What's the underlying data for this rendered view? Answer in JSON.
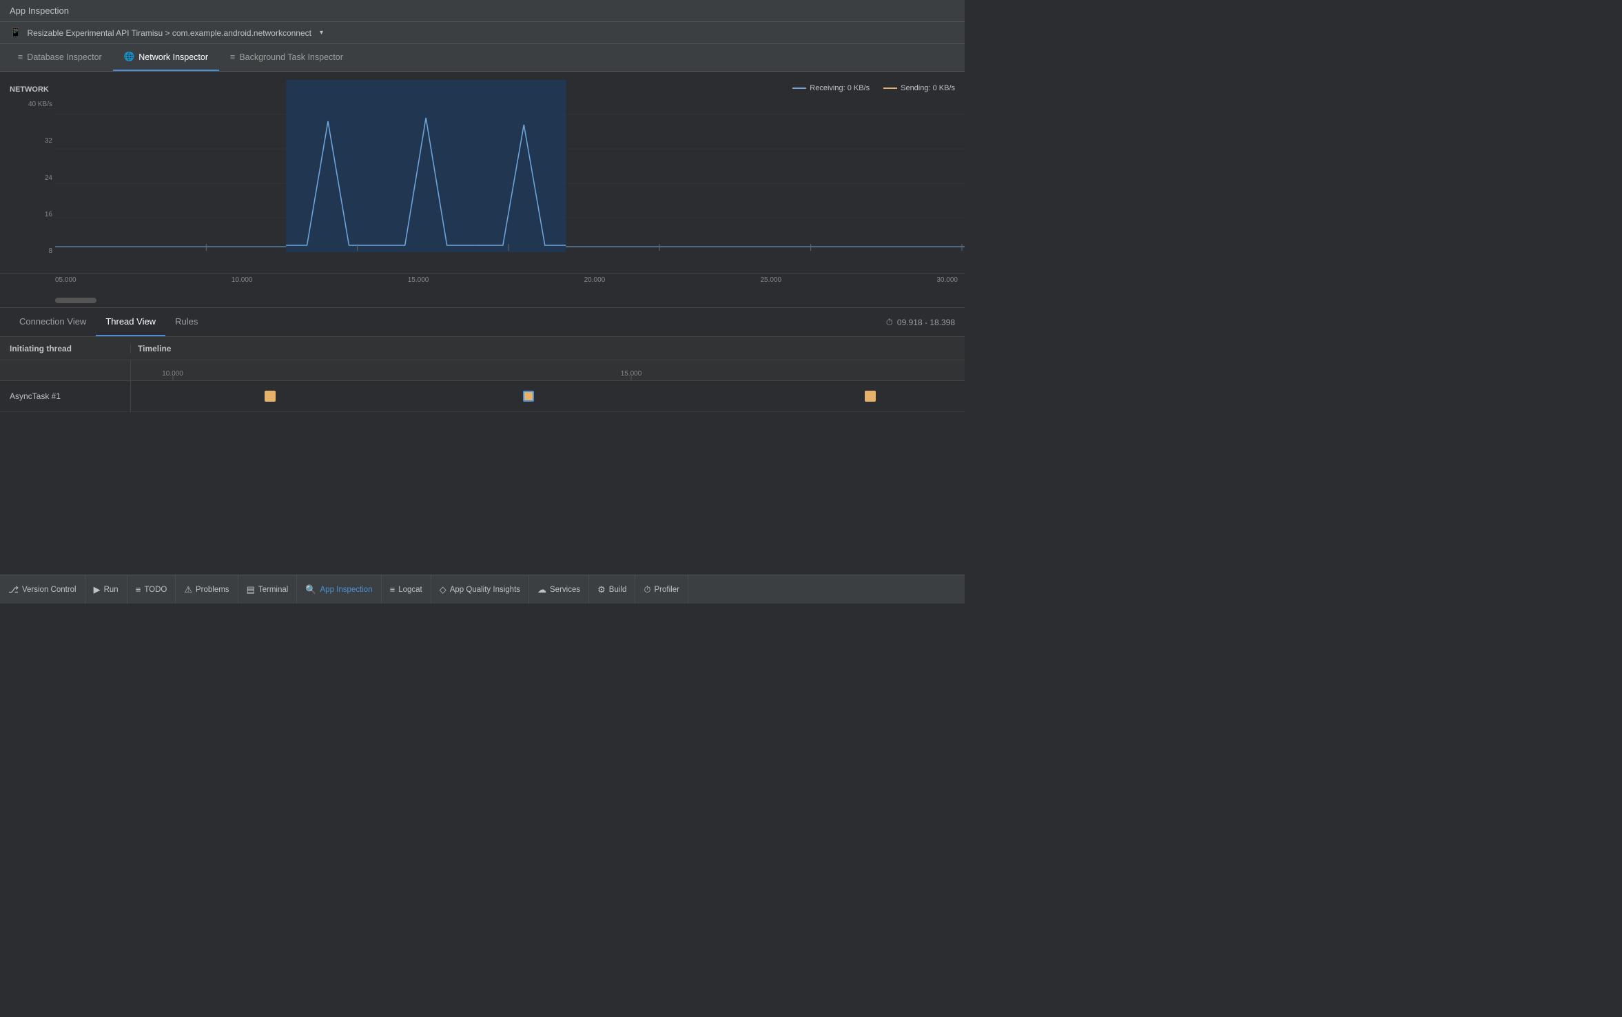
{
  "title_bar": {
    "label": "App Inspection"
  },
  "device_bar": {
    "icon": "📱",
    "label": "Resizable Experimental API Tiramisu > com.example.android.networkconnect",
    "dropdown_arrow": "▾"
  },
  "inspector_tabs": [
    {
      "id": "database",
      "label": "Database Inspector",
      "icon": "≡",
      "active": false
    },
    {
      "id": "network",
      "label": "Network Inspector",
      "icon": "🌐",
      "active": true
    },
    {
      "id": "background",
      "label": "Background Task Inspector",
      "icon": "≡",
      "active": false
    }
  ],
  "chart": {
    "title": "NETWORK",
    "y_label_top": "40 KB/s",
    "y_ticks": [
      "40 KB/s",
      "32",
      "24",
      "16",
      "8"
    ],
    "x_ticks": [
      "05.000",
      "10.000",
      "15.000",
      "20.000",
      "25.000",
      "30.000"
    ],
    "legend": {
      "receiving_label": "Receiving: 0 KB/s",
      "sending_label": "Sending: 0 KB/s"
    }
  },
  "view_tabs": [
    {
      "id": "connection",
      "label": "Connection View",
      "active": false
    },
    {
      "id": "thread",
      "label": "Thread View",
      "active": true
    },
    {
      "id": "rules",
      "label": "Rules",
      "active": false
    }
  ],
  "time_range": "09.918 - 18.398",
  "thread_header": {
    "initiating": "Initiating thread",
    "timeline": "Timeline"
  },
  "time_markers": [
    "10.000",
    "15.000"
  ],
  "thread_rows": [
    {
      "name": "AsyncTask #1",
      "tasks": [
        {
          "left_pct": 16,
          "selected": false
        },
        {
          "left_pct": 47,
          "selected": true
        },
        {
          "left_pct": 88,
          "selected": false
        }
      ]
    }
  ],
  "bottom_toolbar": [
    {
      "id": "version-control",
      "icon": "⎇",
      "label": "Version Control"
    },
    {
      "id": "run",
      "icon": "▶",
      "label": "Run"
    },
    {
      "id": "todo",
      "icon": "≡",
      "label": "TODO"
    },
    {
      "id": "problems",
      "icon": "⚠",
      "label": "Problems"
    },
    {
      "id": "terminal",
      "icon": "▤",
      "label": "Terminal"
    },
    {
      "id": "app-inspection",
      "icon": "🔍",
      "label": "App Inspection",
      "active": true
    },
    {
      "id": "logcat",
      "icon": "≡",
      "label": "Logcat"
    },
    {
      "id": "app-quality",
      "icon": "◇",
      "label": "App Quality Insights"
    },
    {
      "id": "services",
      "icon": "☁",
      "label": "Services"
    },
    {
      "id": "build",
      "icon": "⚙",
      "label": "Build"
    },
    {
      "id": "profiler",
      "icon": "⏱",
      "label": "Profiler"
    }
  ]
}
